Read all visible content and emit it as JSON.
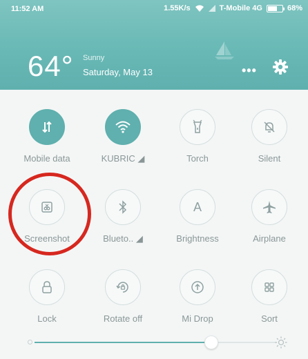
{
  "status_bar": {
    "time": "11:52 AM",
    "speed": "1.55K/s",
    "carrier": "T-Mobile 4G",
    "battery": "68%",
    "battery_level": 0.68,
    "icons": [
      "wifi-icon",
      "signal-icon",
      "battery-icon"
    ]
  },
  "weather": {
    "temperature": "64°",
    "condition": "Sunny",
    "date": "Saturday, May 13",
    "more_label": "•••"
  },
  "toggles": [
    {
      "label": "Mobile data",
      "icon": "mobile-data-icon",
      "active": true
    },
    {
      "label": "KUBRIC ◢",
      "icon": "wifi-icon",
      "active": true
    },
    {
      "label": "Torch",
      "icon": "torch-icon",
      "active": false
    },
    {
      "label": "Silent",
      "icon": "silent-icon",
      "active": false
    },
    {
      "label": "Screenshot",
      "icon": "screenshot-icon",
      "active": false
    },
    {
      "label": "Blueto.. ◢",
      "icon": "bluetooth-icon",
      "active": false
    },
    {
      "label": "Brightness",
      "icon": "brightness-icon",
      "glyph": "A",
      "active": false
    },
    {
      "label": "Airplane",
      "icon": "airplane-icon",
      "active": false
    },
    {
      "label": "Lock",
      "icon": "lock-icon",
      "active": false
    },
    {
      "label": "Rotate off",
      "icon": "rotate-icon",
      "active": false
    },
    {
      "label": "Mi Drop",
      "icon": "mi-drop-icon",
      "active": false
    },
    {
      "label": "Sort",
      "icon": "sort-icon",
      "active": false
    }
  ],
  "brightness_slider": {
    "value": 0.73
  },
  "colors": {
    "accent": "#5fb0ae",
    "highlight_ring": "#d6281f",
    "label": "#8a9696"
  }
}
